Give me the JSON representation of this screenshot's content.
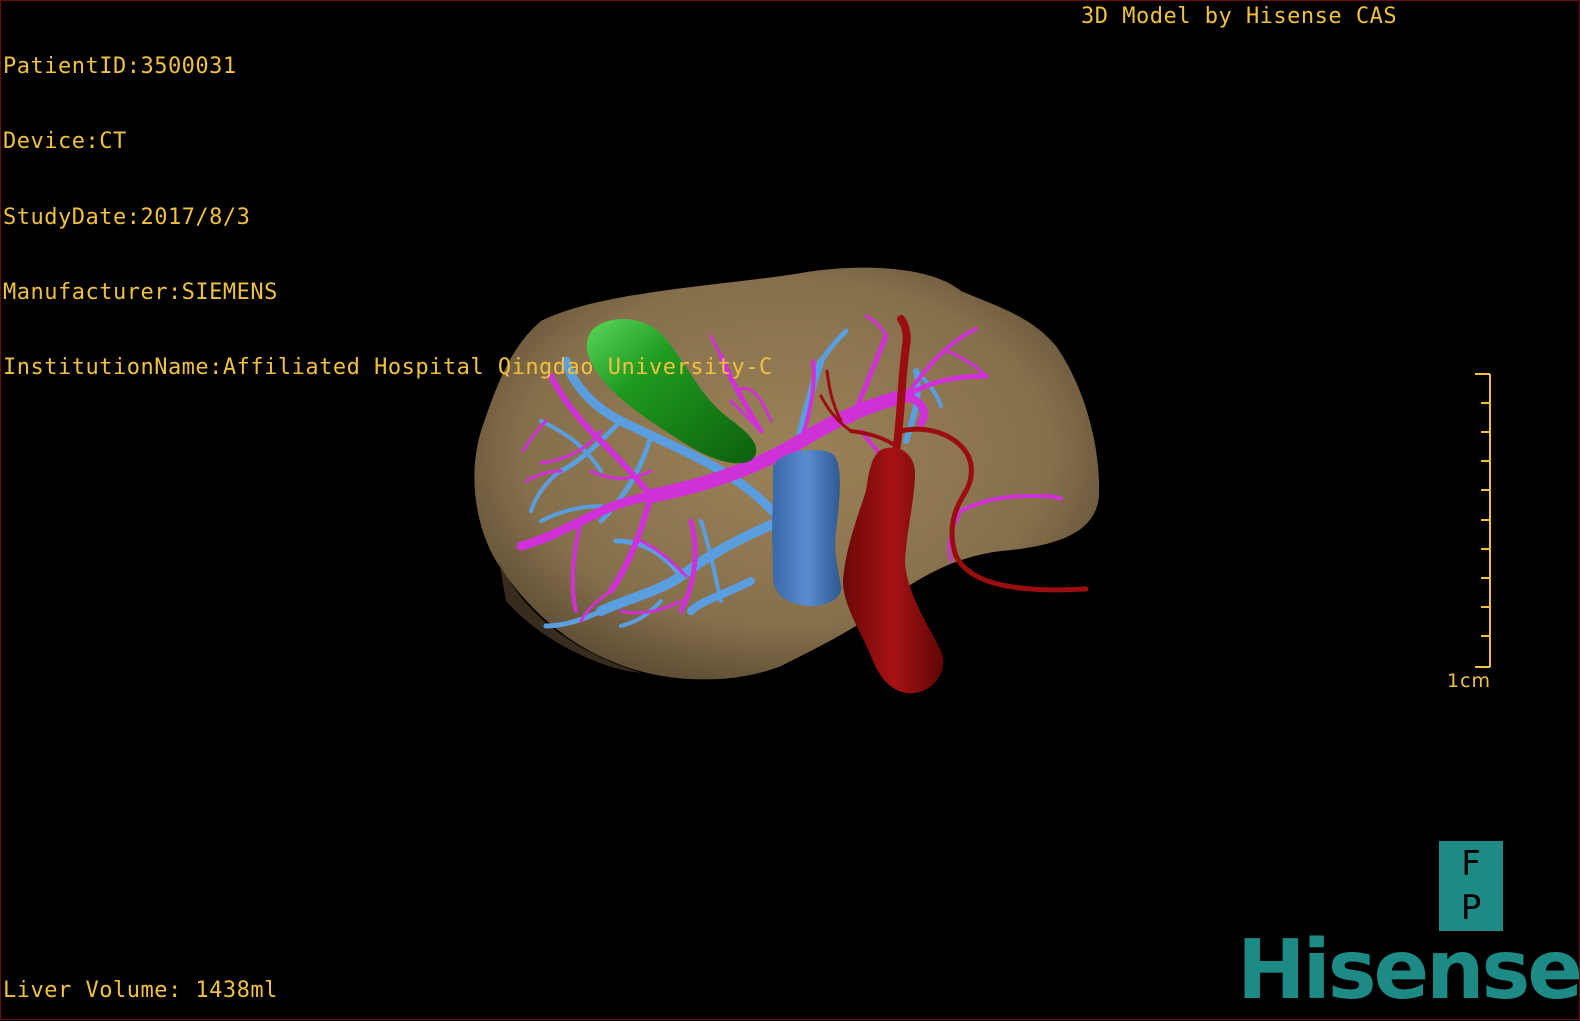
{
  "patient_info": {
    "patient_id": "PatientID:3500031",
    "device": "Device:CT",
    "study_date": "StudyDate:2017/8/3",
    "manufacturer": "Manufacturer:SIEMENS",
    "institution": "InstitutionName:Affiliated Hospital Qingdao University-C"
  },
  "credit": "3D Model by Hisense CAS",
  "liver_volume": "Liver Volume: 1438ml",
  "scale": {
    "label": "1cm"
  },
  "orientation_badge": {
    "top": "F",
    "bottom": "P"
  },
  "brand": "Hisense",
  "colors": {
    "overlay_text": "#f0c040",
    "liver": "#8a7350",
    "gallbladder": "#1f9a1f",
    "portal_vein": "#d030d8",
    "hepatic_vein": "#5a9ee0",
    "ivc": "#4a78b8",
    "artery": "#9a0e10",
    "brand": "#1d8a86"
  }
}
